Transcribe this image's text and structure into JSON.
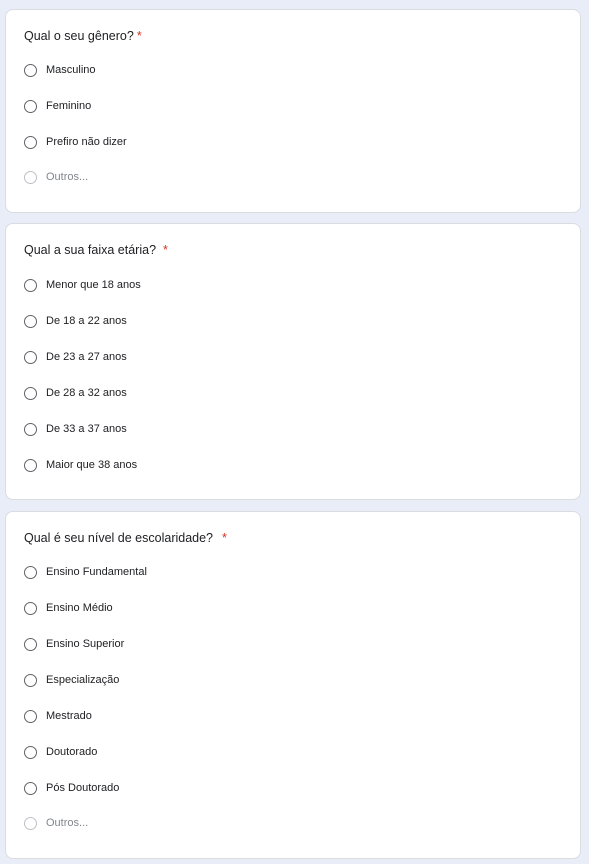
{
  "questions": [
    {
      "title": "Qual o seu gênero?",
      "required_mark": "*",
      "options": [
        "Masculino",
        "Feminino",
        "Prefiro não dizer"
      ],
      "other_label": "Outros..."
    },
    {
      "title": "Qual a sua faixa etária?",
      "required_mark": "*",
      "options": [
        "Menor que 18 anos",
        "De 18 a 22 anos",
        "De 23 a 27 anos",
        "De 28 a 32 anos",
        "De 33 a 37 anos",
        "Maior que 38 anos"
      ]
    },
    {
      "title": "Qual é seu nível de escolaridade?",
      "required_mark": "*",
      "options": [
        "Ensino Fundamental",
        "Ensino Médio",
        "Ensino Superior",
        "Especialização",
        "Mestrado",
        "Doutorado",
        "Pós Doutorado"
      ],
      "other_label": "Outros..."
    }
  ],
  "colors": {
    "page_background": "#e8edf8",
    "required_mark": "#d93025",
    "radio_border": "#5f6368"
  }
}
